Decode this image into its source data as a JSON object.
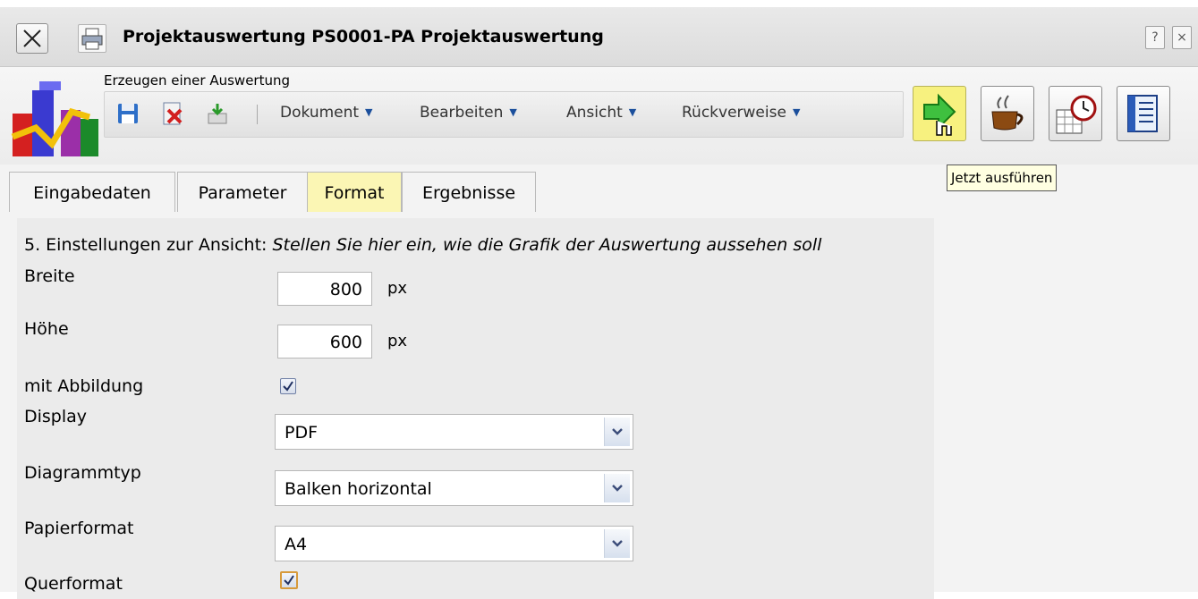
{
  "window": {
    "title": "Projektauswertung PS0001-PA Projektauswertung",
    "help_label": "?",
    "close_label": "×"
  },
  "toolbar": {
    "subtitle": "Erzeugen einer Auswertung",
    "menus": [
      "Dokument",
      "Bearbeiten",
      "Ansicht",
      "Rückverweise"
    ],
    "tooltip": "Jetzt ausführen"
  },
  "tabs": [
    "Eingabedaten",
    "Parameter",
    "Format",
    "Ergebnisse"
  ],
  "active_tab": "Format",
  "form": {
    "heading_prefix": "5. Einstellungen zur Ansicht: ",
    "heading_hint": "Stellen Sie hier ein, wie die Grafik der Auswertung aussehen soll",
    "breite_label": "Breite",
    "breite_value": "800",
    "breite_unit": "px",
    "hoehe_label": "Höhe",
    "hoehe_value": "600",
    "hoehe_unit": "px",
    "abbildung_label": "mit Abbildung",
    "abbildung_checked": true,
    "display_label": "Display",
    "display_value": "PDF",
    "diagrammtyp_label": "Diagrammtyp",
    "diagrammtyp_value": "Balken horizontal",
    "papierformat_label": "Papierformat",
    "papierformat_value": "A4",
    "querformat_label": "Querformat",
    "querformat_checked": true
  },
  "colors": {
    "active_tab": "#fbf6b4",
    "run_button": "#f7f17f",
    "tooltip_bg": "#ffffe1",
    "menu_arrow": "#1b4f9c"
  },
  "icons": [
    "close-icon",
    "printer-icon",
    "report-chart-logo",
    "save-icon",
    "delete-icon",
    "export-icon",
    "run-arrow-icon",
    "coffee-cup-icon",
    "calendar-clock-icon",
    "settings-sheet-icon",
    "help-icon",
    "chevron-down-icon",
    "checkmark-icon"
  ]
}
